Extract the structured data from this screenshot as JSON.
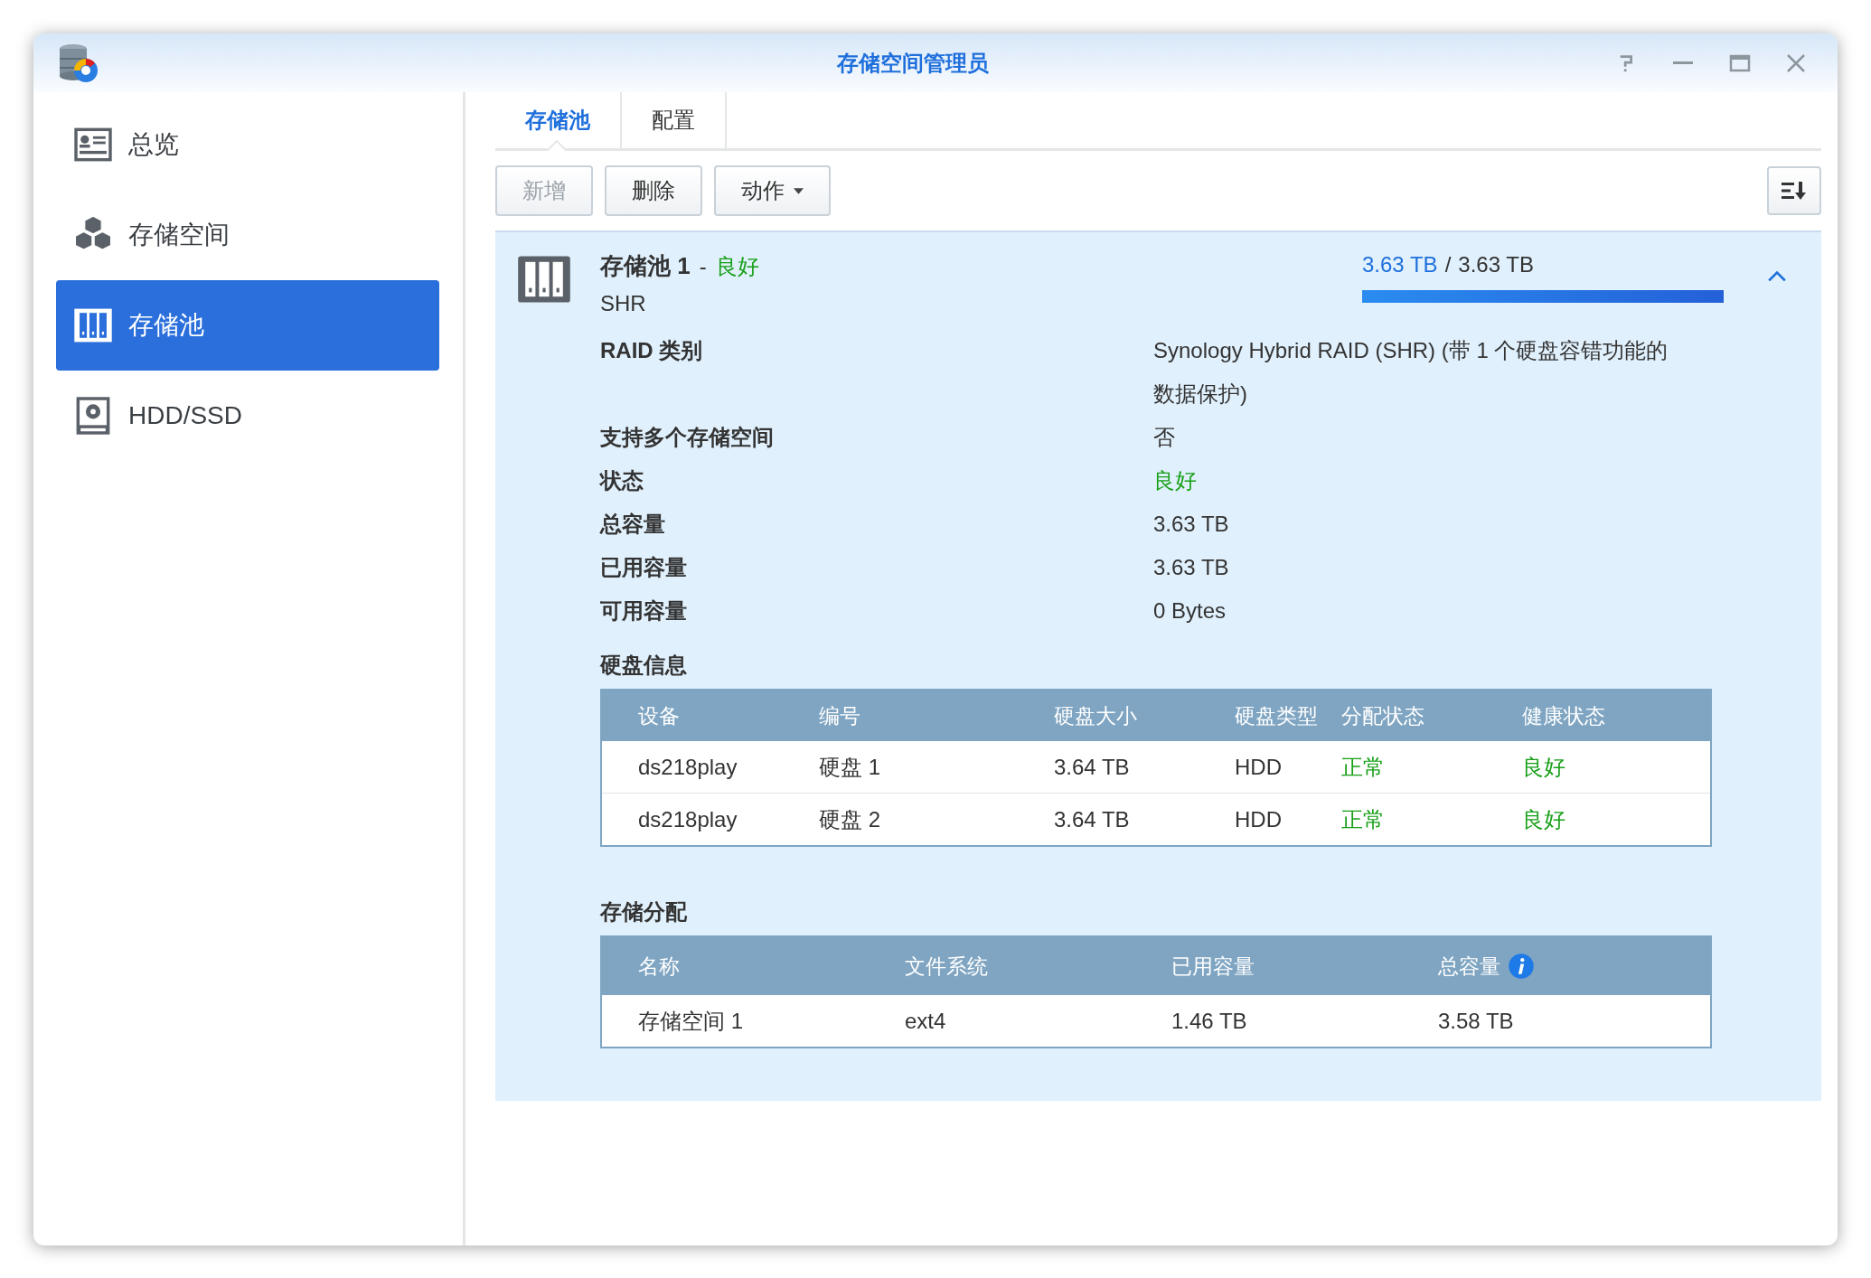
{
  "window": {
    "title": "存储空间管理员"
  },
  "sidebar": {
    "items": [
      {
        "label": "总览",
        "kind": "overview",
        "selected": false
      },
      {
        "label": "存储空间",
        "kind": "volume",
        "selected": false
      },
      {
        "label": "存储池",
        "kind": "pool",
        "selected": true
      },
      {
        "label": "HDD/SSD",
        "kind": "disk",
        "selected": false
      }
    ]
  },
  "tabs": [
    {
      "label": "存储池",
      "selected": true
    },
    {
      "label": "配置",
      "selected": false
    }
  ],
  "toolbar": {
    "buttons": [
      {
        "label": "新增",
        "disabled": true,
        "dropdown": false
      },
      {
        "label": "删除",
        "disabled": false,
        "dropdown": false
      },
      {
        "label": "动作",
        "disabled": false,
        "dropdown": true
      }
    ]
  },
  "pool": {
    "name": "存储池 1",
    "separator": "-",
    "status": "良好",
    "status_good": true,
    "type": "SHR",
    "used": "3.63 TB",
    "slash": "/",
    "total": "3.63 TB",
    "level": 1.0,
    "expanded": true,
    "details": [
      {
        "label": "RAID 类别",
        "value": "Synology Hybrid RAID (SHR) (带 1 个硬盘容错功能的数据保护)",
        "good": false
      },
      {
        "label": "支持多个存储空间",
        "value": "否",
        "good": false
      },
      {
        "label": "状态",
        "value": "良好",
        "good": true
      },
      {
        "label": "总容量",
        "value": "3.63 TB",
        "good": false
      },
      {
        "label": "已用容量",
        "value": "3.63 TB",
        "good": false
      },
      {
        "label": "可用容量",
        "value": "0 Bytes",
        "good": false
      }
    ],
    "disk_info": {
      "title": "硬盘信息",
      "columns": [
        "设备",
        "编号",
        "硬盘大小",
        "硬盘类型",
        "分配状态",
        "健康状态"
      ],
      "rows": [
        {
          "cells": [
            {
              "text": "ds218play",
              "good": false
            },
            {
              "text": "硬盘 1",
              "good": false
            },
            {
              "text": "3.64 TB",
              "good": false
            },
            {
              "text": "HDD",
              "good": false
            },
            {
              "text": "正常",
              "good": true
            },
            {
              "text": "良好",
              "good": true
            }
          ]
        },
        {
          "cells": [
            {
              "text": "ds218play",
              "good": false
            },
            {
              "text": "硬盘 2",
              "good": false
            },
            {
              "text": "3.64 TB",
              "good": false
            },
            {
              "text": "HDD",
              "good": false
            },
            {
              "text": "正常",
              "good": true
            },
            {
              "text": "良好",
              "good": true
            }
          ]
        }
      ]
    },
    "allocation": {
      "title": "存储分配",
      "columns": [
        {
          "label": "名称",
          "info": false
        },
        {
          "label": "文件系统",
          "info": false
        },
        {
          "label": "已用容量",
          "info": false
        },
        {
          "label": "总容量",
          "info": true
        }
      ],
      "rows": [
        {
          "cells": [
            "存储空间 1",
            "ext4",
            "1.46 TB",
            "3.58 TB"
          ]
        }
      ]
    }
  }
}
